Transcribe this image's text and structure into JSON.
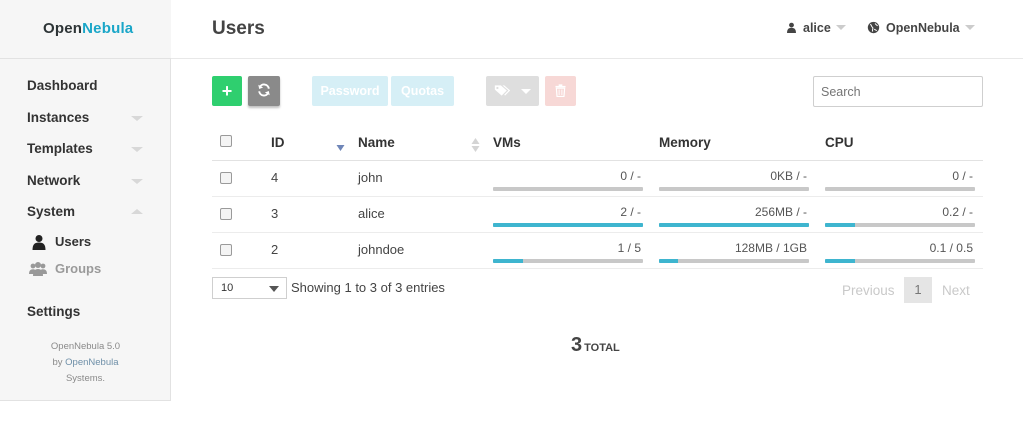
{
  "brand": {
    "open": "Open",
    "nebula": "Nebula"
  },
  "sidebar": {
    "items": [
      {
        "label": "Dashboard",
        "caret": "none"
      },
      {
        "label": "Instances",
        "caret": "down"
      },
      {
        "label": "Templates",
        "caret": "down"
      },
      {
        "label": "Network",
        "caret": "down"
      },
      {
        "label": "System",
        "caret": "up"
      }
    ],
    "sub_items": [
      {
        "label": "Users",
        "icon": "user-icon",
        "active": true
      },
      {
        "label": "Groups",
        "icon": "users-icon",
        "active": false
      }
    ],
    "settings": "Settings",
    "footer": {
      "version": "OpenNebula 5.0",
      "by": "by",
      "company": "OpenNebula",
      "suffix": "Systems."
    }
  },
  "header": {
    "title": "Users",
    "user": "alice",
    "zone": "OpenNebula"
  },
  "toolbar": {
    "create_icon": "+",
    "password_label": "Password",
    "quotas_label": "Quotas",
    "search_placeholder": "Search"
  },
  "table": {
    "columns": {
      "id": "ID",
      "name": "Name",
      "vms": "VMs",
      "memory": "Memory",
      "cpu": "CPU"
    },
    "rows": [
      {
        "id": "4",
        "name": "john",
        "vms": {
          "text": "0 / -",
          "fill": 0
        },
        "memory": {
          "text": "0KB / -",
          "fill": 0
        },
        "cpu": {
          "text": "0 / -",
          "fill": 0
        }
      },
      {
        "id": "3",
        "name": "alice",
        "vms": {
          "text": "2 / -",
          "fill": 1
        },
        "memory": {
          "text": "256MB / -",
          "fill": 1
        },
        "cpu": {
          "text": "0.2 / -",
          "fill": 0.2
        }
      },
      {
        "id": "2",
        "name": "johndoe",
        "vms": {
          "text": "1 / 5",
          "fill": 0.2
        },
        "memory": {
          "text": "128MB / 1GB",
          "fill": 0.125
        },
        "cpu": {
          "text": "0.1 / 0.5",
          "fill": 0.2
        }
      }
    ]
  },
  "pagination": {
    "page_length": "10",
    "info": "Showing 1 to 3 of 3 entries",
    "previous": "Previous",
    "current": "1",
    "next": "Next"
  },
  "summary": {
    "total": "3",
    "label": "TOTAL"
  },
  "colors": {
    "accent": "#1aa6c8",
    "create": "#2fcf6f",
    "bar_fill": "#3eb5cf"
  }
}
